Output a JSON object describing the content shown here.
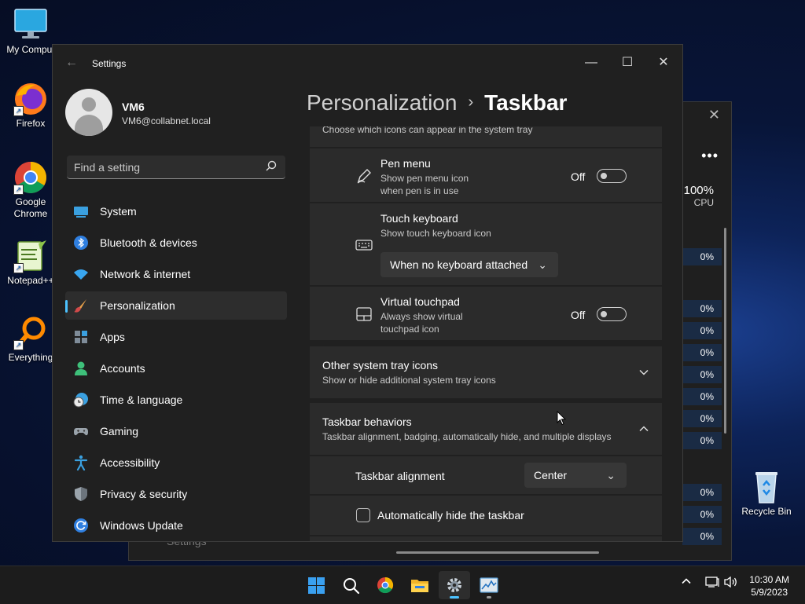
{
  "desktop": {
    "icons": [
      {
        "label": "My Comput"
      },
      {
        "label": "Firefox"
      },
      {
        "label": "Google Chrome"
      },
      {
        "label": "Notepad++"
      },
      {
        "label": "Everything"
      },
      {
        "label": "Recycle Bin"
      }
    ]
  },
  "task_manager": {
    "cpu_percent": "100%",
    "cpu_label": "CPU",
    "row_values": [
      "0%",
      "0%",
      "0%",
      "0%",
      "0%",
      "0%",
      "0%",
      "0%",
      "0%",
      "0%",
      "0%"
    ],
    "ghost_text": "Settings"
  },
  "window": {
    "title": "Settings",
    "controls": {
      "minimize": "—",
      "maximize": "☐",
      "close": "✕"
    }
  },
  "user": {
    "name": "VM6",
    "email": "VM6@collabnet.local"
  },
  "search": {
    "placeholder": "Find a setting"
  },
  "nav": {
    "items": [
      {
        "label": "System",
        "icon": "monitor-icon"
      },
      {
        "label": "Bluetooth & devices",
        "icon": "bluetooth-icon"
      },
      {
        "label": "Network & internet",
        "icon": "wifi-icon"
      },
      {
        "label": "Personalization",
        "icon": "paintbrush-icon",
        "selected": true
      },
      {
        "label": "Apps",
        "icon": "apps-icon"
      },
      {
        "label": "Accounts",
        "icon": "person-icon"
      },
      {
        "label": "Time & language",
        "icon": "clock-globe-icon"
      },
      {
        "label": "Gaming",
        "icon": "gamepad-icon"
      },
      {
        "label": "Accessibility",
        "icon": "accessibility-icon"
      },
      {
        "label": "Privacy & security",
        "icon": "shield-icon"
      },
      {
        "label": "Windows Update",
        "icon": "update-icon"
      }
    ]
  },
  "breadcrumb": {
    "parent": "Personalization",
    "separator": "›",
    "current": "Taskbar"
  },
  "system_tray_section": {
    "header_sub": "Choose which icons can appear in the system tray",
    "pen_menu": {
      "title": "Pen menu",
      "sub_line1": "Show pen menu icon",
      "sub_line2": "when pen is in use",
      "state": "Off"
    },
    "touch_keyboard": {
      "title": "Touch keyboard",
      "sub": "Show touch keyboard icon",
      "dropdown_value": "When no keyboard attached"
    },
    "virtual_touchpad": {
      "title": "Virtual touchpad",
      "sub_line1": "Always show virtual",
      "sub_line2": "touchpad icon",
      "state": "Off"
    }
  },
  "other_tray_icons": {
    "title": "Other system tray icons",
    "sub": "Show or hide additional system tray icons"
  },
  "taskbar_behaviors": {
    "title": "Taskbar behaviors",
    "sub": "Taskbar alignment, badging, automatically hide, and multiple displays",
    "alignment_label": "Taskbar alignment",
    "alignment_value": "Center",
    "autohide_label": "Automatically hide the taskbar",
    "autohide_checked": false
  },
  "taskbar": {
    "time": "10:30 AM",
    "date": "5/9/2023"
  },
  "colors": {
    "accent": "#4cc2ff",
    "window_bg": "#202020",
    "card_bg": "#2b2b2b"
  }
}
